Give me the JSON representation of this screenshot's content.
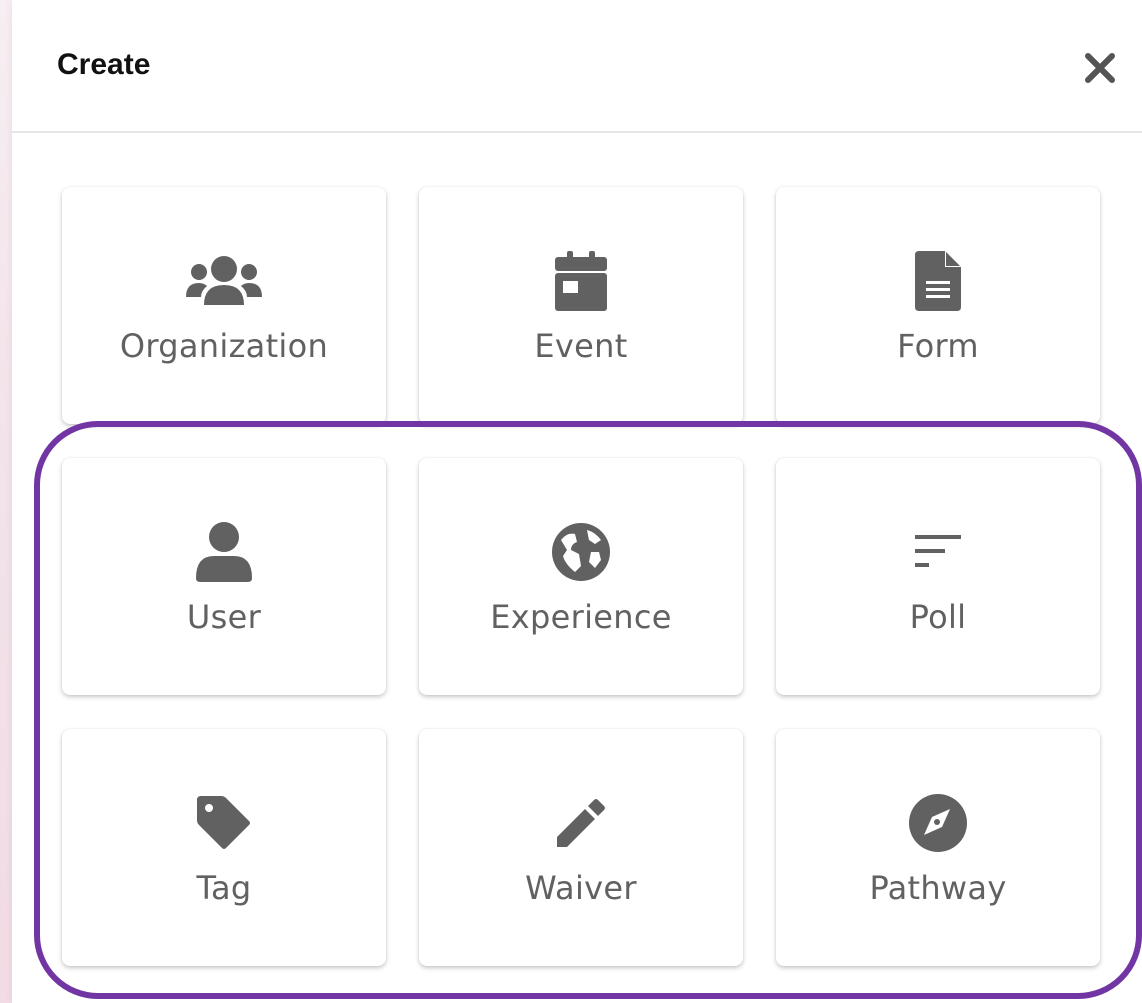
{
  "dialog": {
    "title": "Create",
    "close_icon": "close-icon"
  },
  "options": [
    {
      "label": "Organization",
      "icon": "group-icon"
    },
    {
      "label": "Event",
      "icon": "calendar-icon"
    },
    {
      "label": "Form",
      "icon": "document-icon"
    },
    {
      "label": "User",
      "icon": "user-icon"
    },
    {
      "label": "Experience",
      "icon": "globe-icon"
    },
    {
      "label": "Poll",
      "icon": "sort-lines-icon"
    },
    {
      "label": "Tag",
      "icon": "tag-icon"
    },
    {
      "label": "Waiver",
      "icon": "pencil-icon"
    },
    {
      "label": "Pathway",
      "icon": "compass-icon"
    }
  ],
  "colors": {
    "icon": "#616161",
    "label": "#616161",
    "highlight": "#7236a4",
    "title": "#111111"
  }
}
